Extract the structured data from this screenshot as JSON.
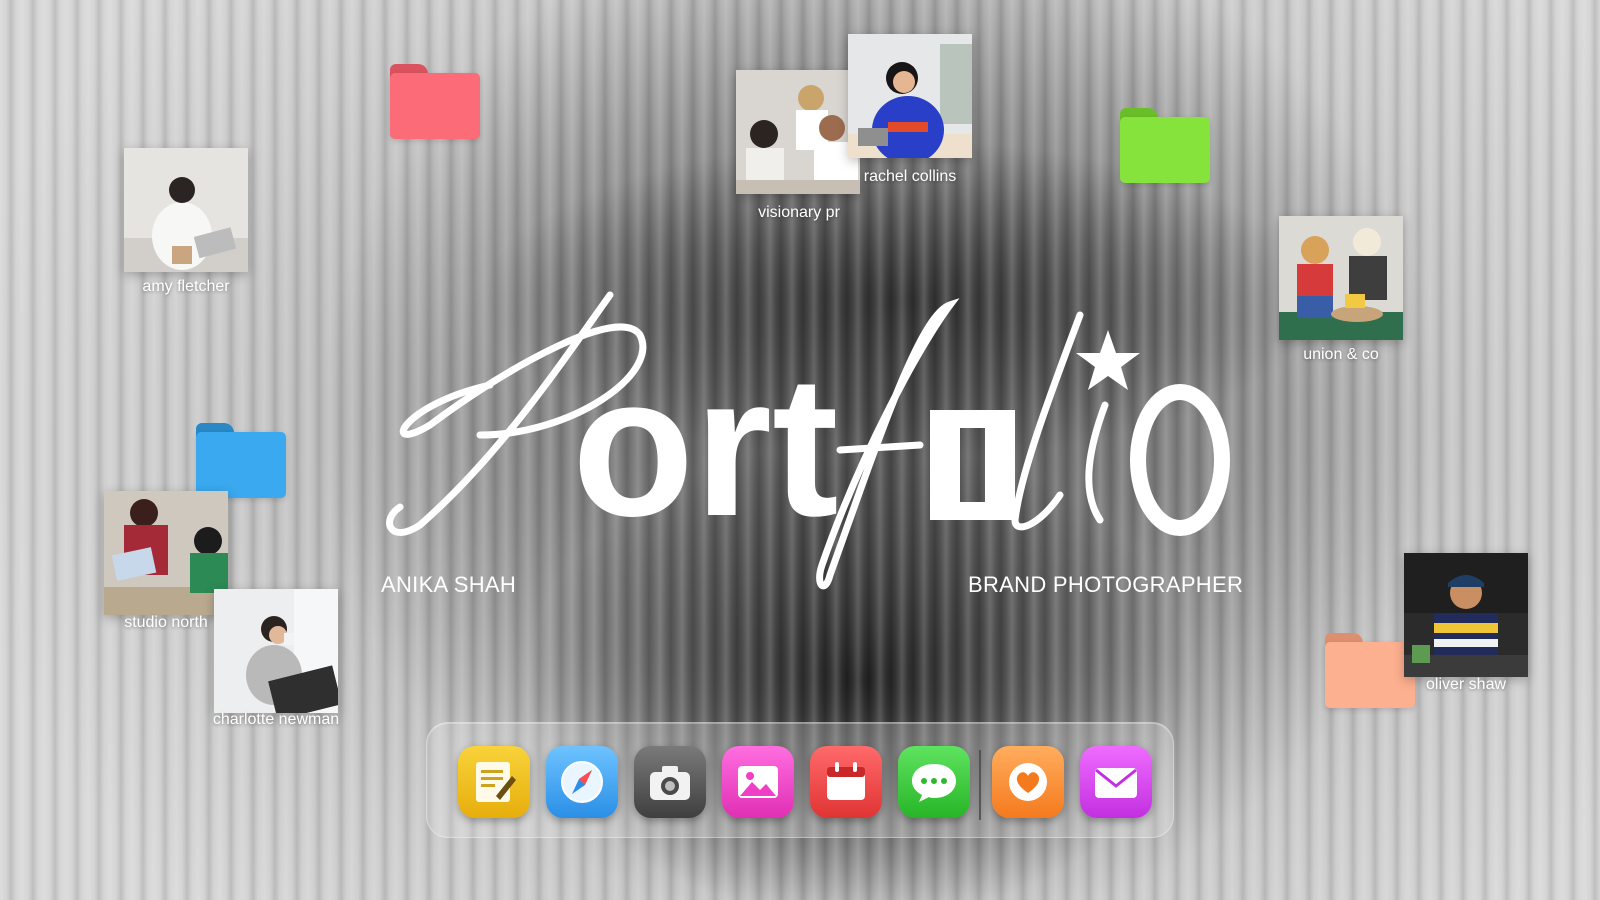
{
  "title": {
    "word": "Portfolio",
    "name": "ANIKA SHAH",
    "role": "BRAND PHOTOGRAPHER"
  },
  "photos": [
    {
      "id": "amy",
      "caption": "amy fletcher"
    },
    {
      "id": "visionary",
      "caption": "visionary pr"
    },
    {
      "id": "rachel",
      "caption": "rachel collins"
    },
    {
      "id": "union",
      "caption": "union & co"
    },
    {
      "id": "studio",
      "caption": "studio north"
    },
    {
      "id": "charlotte",
      "caption": "charlotte newman"
    },
    {
      "id": "oliver",
      "caption": "oliver shaw"
    }
  ],
  "folders": [
    {
      "id": "red",
      "color": "#fb6b78"
    },
    {
      "id": "green",
      "color": "#86e33b"
    },
    {
      "id": "blue",
      "color": "#3aa9ef"
    },
    {
      "id": "peach",
      "color": "#fdb08f"
    }
  ],
  "dock": {
    "apps": [
      {
        "id": "notes",
        "icon": "notes-icon",
        "color": "#f3c317"
      },
      {
        "id": "safari",
        "icon": "compass-icon",
        "color": "#3aa0ee"
      },
      {
        "id": "camera",
        "icon": "camera-icon",
        "color": "#5c5c5c"
      },
      {
        "id": "photos",
        "icon": "gallery-icon",
        "color": "#f03ec6"
      },
      {
        "id": "calendar",
        "icon": "calendar-icon",
        "color": "#f04646"
      },
      {
        "id": "messages",
        "icon": "chat-bubble-icon",
        "color": "#3fcf3f"
      },
      {
        "id": "favorites",
        "icon": "heart-icon",
        "color": "#fd8a2d"
      },
      {
        "id": "mail",
        "icon": "envelope-icon",
        "color": "#d43ef0"
      }
    ]
  }
}
